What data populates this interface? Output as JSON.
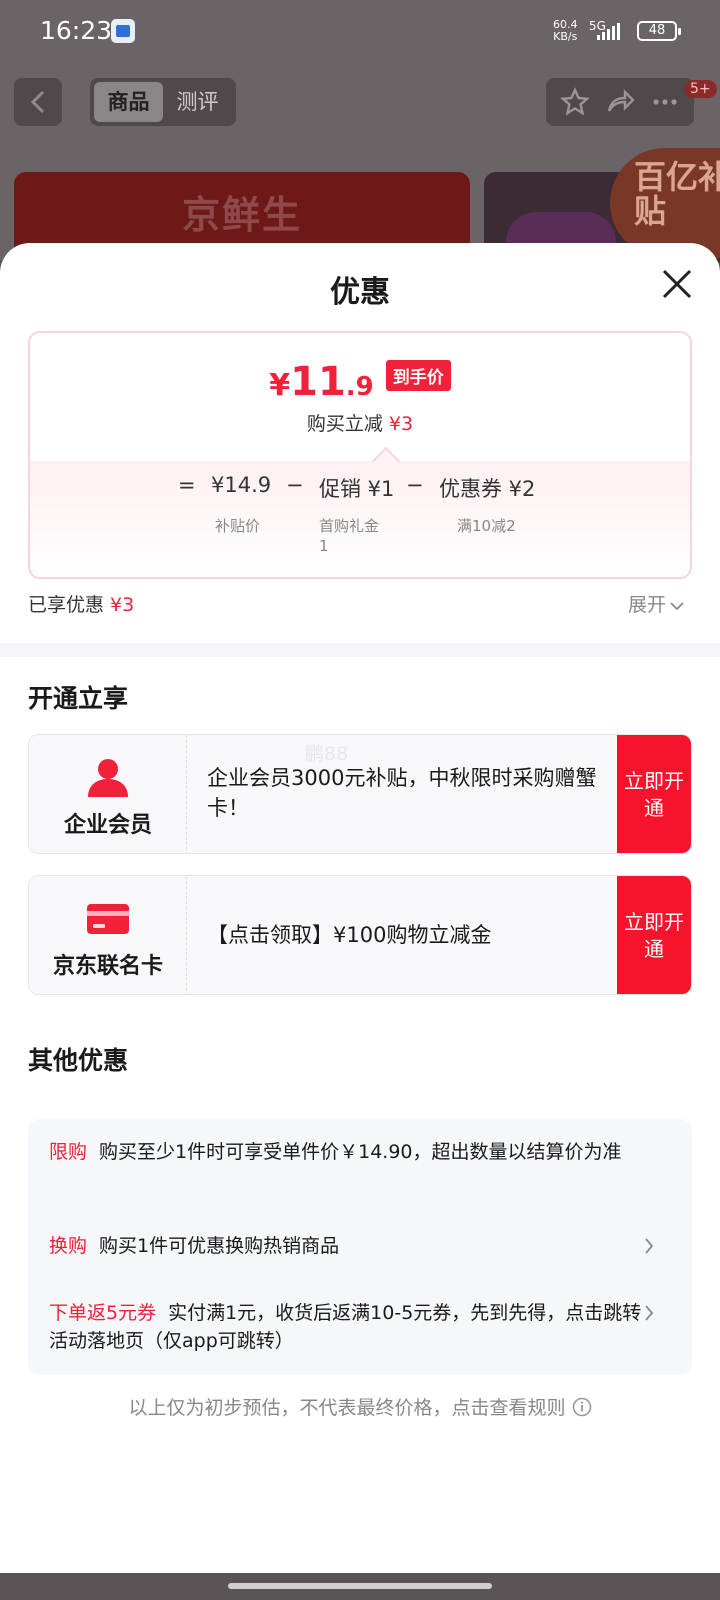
{
  "status_bar": {
    "time": "16:23",
    "net_speed": "60.4",
    "net_unit": "KB/s",
    "network": "5G",
    "battery": "48"
  },
  "header": {
    "tabs": [
      "商品",
      "测评"
    ],
    "active_tab": "商品",
    "badge": "5+",
    "icons": [
      "back-icon",
      "star-icon",
      "share-icon",
      "more-icon"
    ]
  },
  "background": {
    "banner_title": "京鲜生",
    "subsidy_badge": "百亿补贴"
  },
  "sheet": {
    "title": "优惠",
    "final_price": {
      "currency": "¥",
      "integer": "11",
      "decimal": ".9",
      "tag": "到手价"
    },
    "buy_reduce": {
      "label": "购买立减",
      "amount": "¥3"
    },
    "formula": {
      "equals": "=",
      "minus": "−",
      "items": [
        {
          "value": "¥14.9",
          "desc": "补贴价"
        },
        {
          "value": "促销 ¥1",
          "desc": "首购礼金",
          "desc2": "1"
        },
        {
          "value": "优惠券 ¥2",
          "desc": "满10减2"
        }
      ]
    },
    "enjoyed": {
      "label": "已享优惠",
      "amount": "¥3"
    },
    "expand_label": "展开",
    "open_section": {
      "title": "开通立享",
      "watermark": "鹏88",
      "cards": [
        {
          "label": "企业会员",
          "icon": "person-icon",
          "text": "企业会员3000元补贴，中秋限时采购赠蟹卡！",
          "button": "立即开通"
        },
        {
          "label": "京东联名卡",
          "icon": "credit-card-icon",
          "text": "【点击领取】¥100购物立减金",
          "button": "立即开通"
        }
      ]
    },
    "other_section": {
      "title": "其他优惠",
      "rows": [
        {
          "tag": "限购",
          "text": "购买至少1件时可享受单件价￥14.90，超出数量以结算价为准"
        },
        {
          "tag": "换购",
          "text": "购买1件可优惠换购热销商品"
        },
        {
          "tag": "下单返5元券",
          "text": "实付满1元，收货后返满10-5元券，先到先得，点击跳转活动落地页（仅app可跳转）"
        }
      ]
    },
    "footnote": "以上仅为初步预估，不代表最终价格，点击查看规则"
  },
  "colors": {
    "accent_red": "#f2213a",
    "button_red": "#f6142c",
    "card_bg": "#f8f8fb"
  }
}
